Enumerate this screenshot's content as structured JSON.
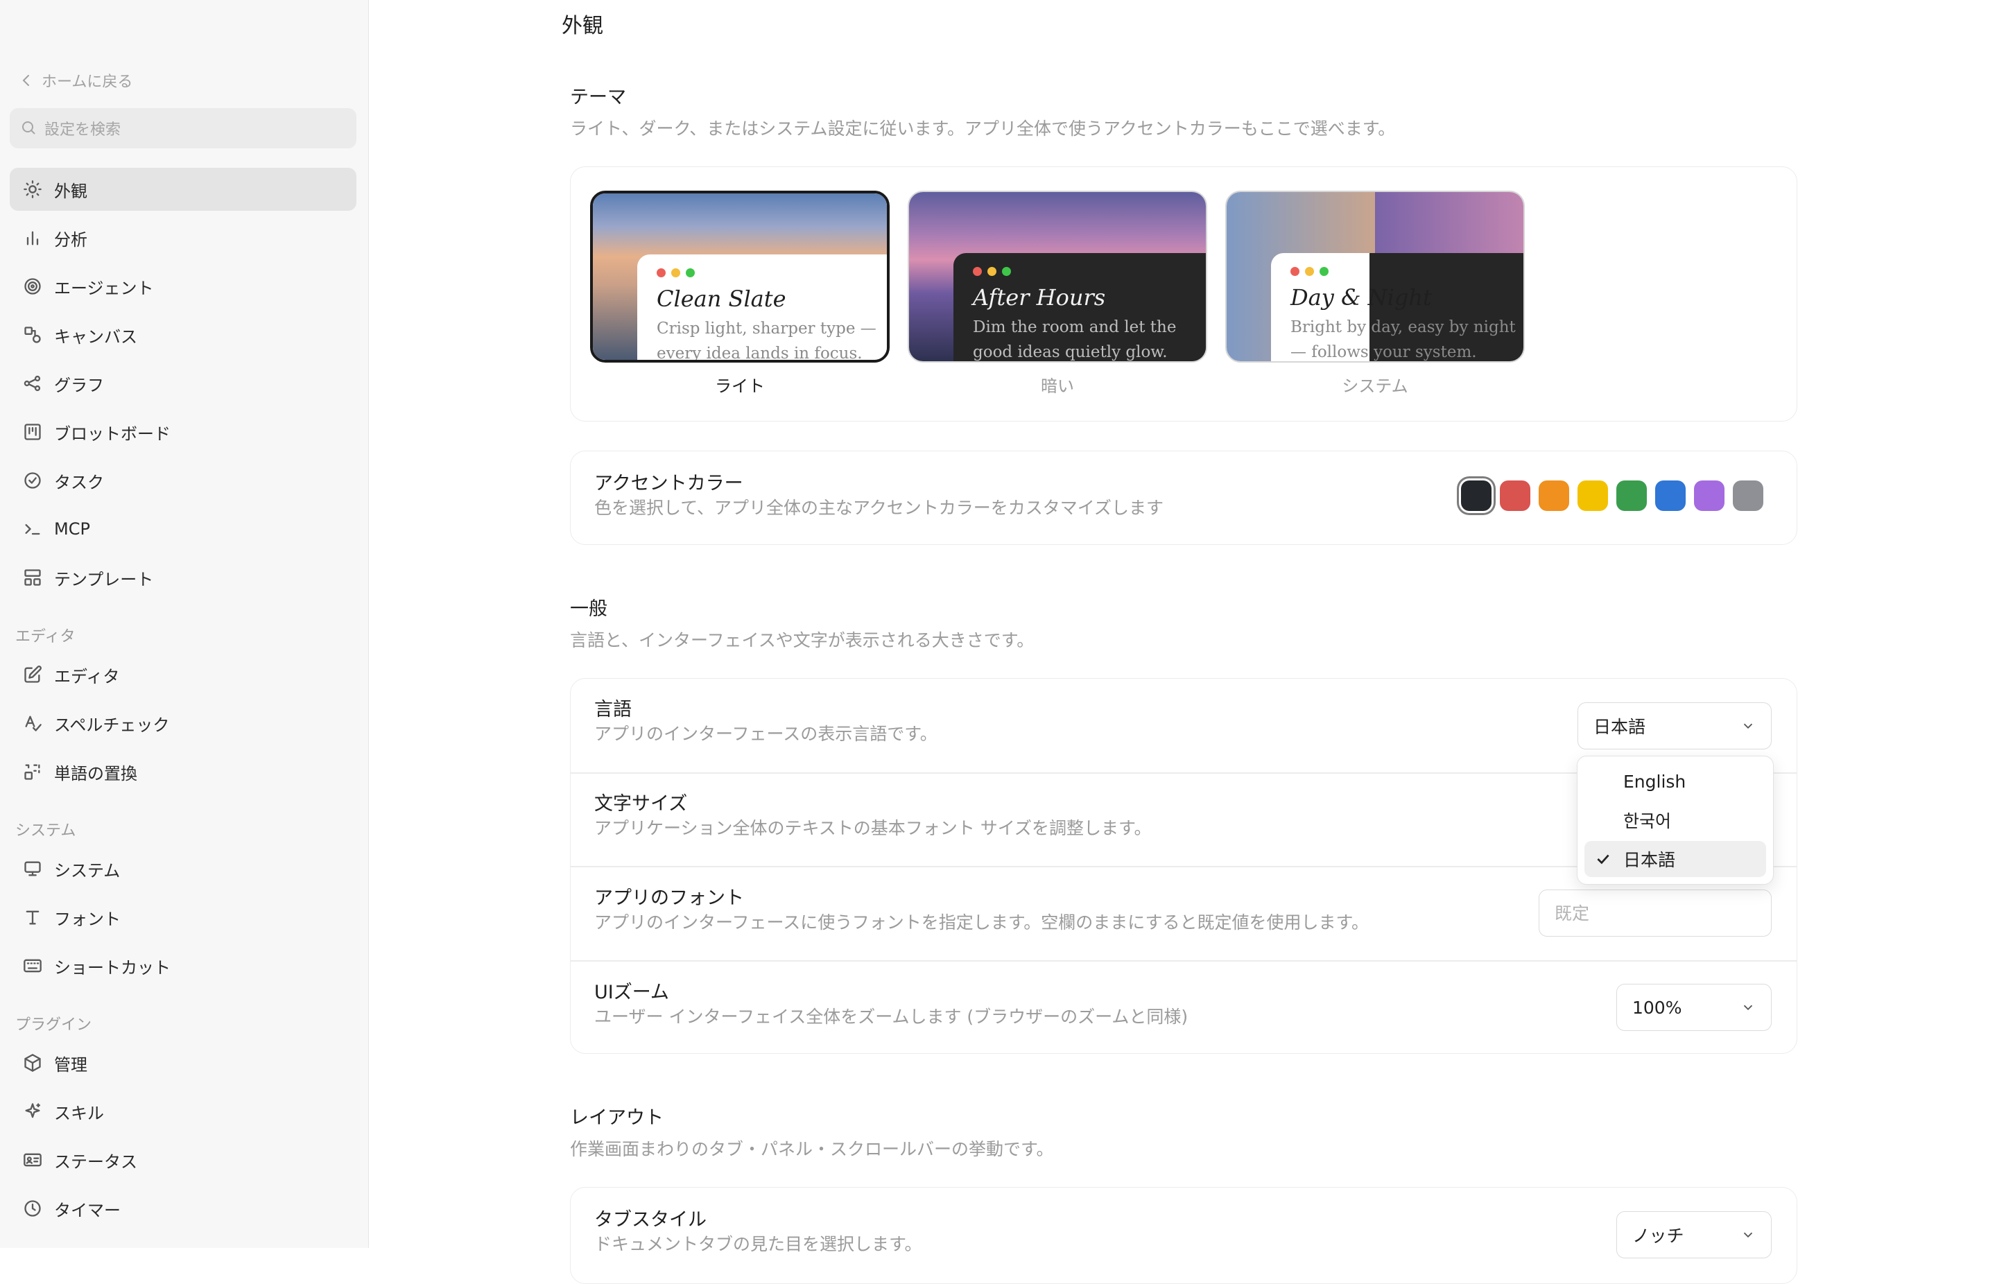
{
  "sidebar": {
    "back_label": "ホームに戻る",
    "search_placeholder": "設定を検索",
    "items": [
      {
        "label": "外観",
        "icon": "sun-icon",
        "active": true
      },
      {
        "label": "分析",
        "icon": "bar-chart-icon"
      },
      {
        "label": "エージェント",
        "icon": "spiral-icon"
      },
      {
        "label": "キャンバス",
        "icon": "canvas-icon"
      },
      {
        "label": "グラフ",
        "icon": "graph-icon"
      },
      {
        "label": "ブロットボード",
        "icon": "board-icon"
      },
      {
        "label": "タスク",
        "icon": "check-circle-icon"
      },
      {
        "label": "MCP",
        "icon": "terminal-icon"
      },
      {
        "label": "テンプレート",
        "icon": "template-icon"
      }
    ],
    "sections": [
      {
        "label": "エディタ",
        "items": [
          {
            "label": "エディタ",
            "icon": "edit-icon"
          },
          {
            "label": "スペルチェック",
            "icon": "spellcheck-icon"
          },
          {
            "label": "単語の置換",
            "icon": "replace-icon"
          }
        ]
      },
      {
        "label": "システム",
        "items": [
          {
            "label": "システム",
            "icon": "monitor-icon"
          },
          {
            "label": "フォント",
            "icon": "font-icon"
          },
          {
            "label": "ショートカット",
            "icon": "keyboard-icon"
          }
        ]
      },
      {
        "label": "プラグイン",
        "items": [
          {
            "label": "管理",
            "icon": "package-icon"
          },
          {
            "label": "スキル",
            "icon": "sparkle-icon"
          },
          {
            "label": "ステータス",
            "icon": "id-card-icon"
          },
          {
            "label": "タイマー",
            "icon": "clock-icon"
          }
        ]
      }
    ]
  },
  "main": {
    "title": "外観",
    "theme": {
      "heading": "テーマ",
      "description": "ライト、ダーク、またはシステム設定に従います。アプリ全体で使うアクセントカラーもここで選べます。",
      "options": [
        {
          "title": "Clean Slate",
          "subtitle": "Crisp light, sharper type — every idea lands in focus.",
          "label": "ライト",
          "selected": true
        },
        {
          "title": "After Hours",
          "subtitle": "Dim the room and let the good ideas quietly glow.",
          "label": "暗い"
        },
        {
          "title": "Day & Night",
          "subtitle": "Bright by day, easy by night — follows your system.",
          "label": "システム"
        }
      ]
    },
    "accent": {
      "title": "アクセントカラー",
      "description": "色を選択して、アプリ全体の主なアクセントカラーをカスタマイズします",
      "colors": [
        "#24272b",
        "#d9534f",
        "#f0901e",
        "#f2c200",
        "#3a9d4d",
        "#2f76d6",
        "#a46be0",
        "#8e9095"
      ],
      "selected_index": 0
    },
    "general": {
      "heading": "一般",
      "description": "言語と、インターフェイスや文字が表示される大きさです。",
      "language": {
        "title": "言語",
        "description": "アプリのインターフェースの表示言語です。",
        "value": "日本語"
      },
      "font_size": {
        "title": "文字サイズ",
        "description": "アプリケーション全体のテキストの基本フォント サイズを調整します。"
      },
      "app_font": {
        "title": "アプリのフォント",
        "description": "アプリのインターフェースに使うフォントを指定します。空欄のままにすると既定値を使用します。",
        "placeholder": "既定"
      },
      "ui_zoom": {
        "title": "UIズーム",
        "description": "ユーザー インターフェイス全体をズームします (ブラウザーのズームと同様)",
        "value": "100%"
      }
    },
    "layout": {
      "heading": "レイアウト",
      "description": "作業画面まわりのタブ・パネル・スクロールバーの挙動です。",
      "tab_style": {
        "title": "タブスタイル",
        "description": "ドキュメントタブの見た目を選択します。",
        "value": "ノッチ"
      }
    },
    "language_dropdown": {
      "options": [
        "English",
        "한국어",
        "日本語"
      ],
      "selected": "日本語"
    }
  }
}
